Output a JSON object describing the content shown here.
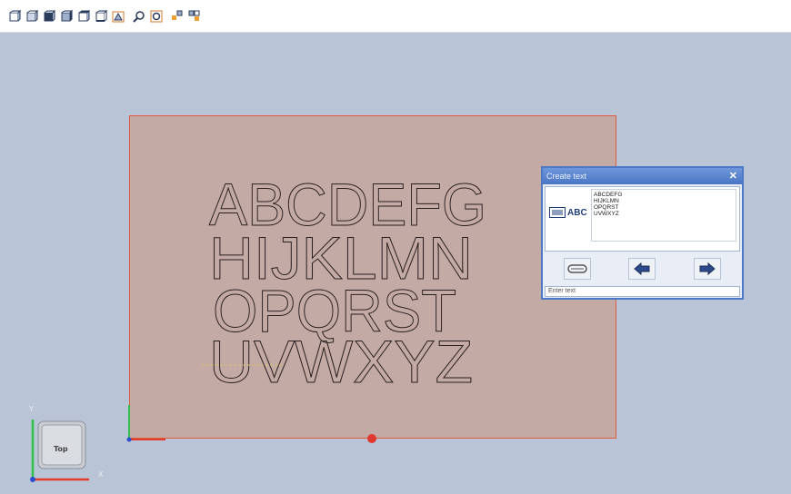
{
  "toolbar": {
    "icons": [
      "view-front-icon",
      "view-back-icon",
      "view-left-icon",
      "view-right-icon",
      "view-top-icon",
      "view-bottom-icon",
      "view-iso-icon",
      "zoom-icon",
      "zoom-fit-icon",
      "snap-icon",
      "grid-icon"
    ]
  },
  "sheet_text": {
    "lines": [
      "ABCDEFG",
      "HIJKLMN",
      "OPQRST",
      "UVWXYZ"
    ]
  },
  "dialog": {
    "title": "Create text",
    "close_label": "✕",
    "icon_label": "ABC",
    "text_lines": [
      "ABCDEFG",
      "HIJKLMN",
      "OPQRST",
      "UVWXYZ"
    ],
    "status": "Enter text"
  },
  "viewcube": {
    "face_label": "Top",
    "x_label": "X",
    "y_label": "Y"
  },
  "colors": {
    "background": "#b9c5d6",
    "sheet": "#c3aaa5",
    "sheet_border": "#e05a3f",
    "dialog_accent": "#4b79c7"
  }
}
